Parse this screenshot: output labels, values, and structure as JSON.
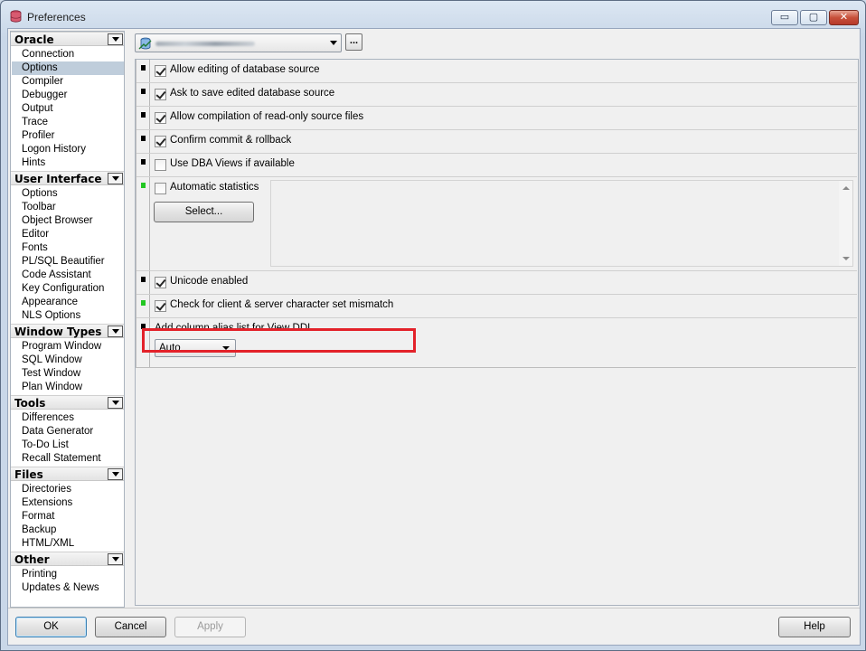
{
  "window": {
    "title": "Preferences",
    "controls": {
      "minimize": "▭",
      "maximize": "▢",
      "close": "✕"
    }
  },
  "sidebar": {
    "categories": [
      {
        "label": "Oracle",
        "items": [
          "Connection",
          "Options",
          "Compiler",
          "Debugger",
          "Output",
          "Trace",
          "Profiler",
          "Logon History",
          "Hints"
        ]
      },
      {
        "label": "User Interface",
        "items": [
          "Options",
          "Toolbar",
          "Object Browser",
          "Editor",
          "Fonts",
          "PL/SQL Beautifier",
          "Code Assistant",
          "Key Configuration",
          "Appearance",
          "NLS Options"
        ]
      },
      {
        "label": "Window Types",
        "items": [
          "Program Window",
          "SQL Window",
          "Test Window",
          "Plan Window"
        ]
      },
      {
        "label": "Tools",
        "items": [
          "Differences",
          "Data Generator",
          "To-Do List",
          "Recall Statement"
        ]
      },
      {
        "label": "Files",
        "items": [
          "Directories",
          "Extensions",
          "Format",
          "Backup",
          "HTML/XML"
        ]
      },
      {
        "label": "Other",
        "items": [
          "Printing",
          "Updates & News"
        ]
      }
    ],
    "selected": "Oracle/Options"
  },
  "top": {
    "dots_label": "..."
  },
  "options": [
    {
      "label": "Allow editing of database source",
      "checked": true
    },
    {
      "label": "Ask to save edited database source",
      "checked": true
    },
    {
      "label": "Allow compilation of read-only source files",
      "checked": true
    },
    {
      "label": "Confirm commit & rollback",
      "checked": true
    },
    {
      "label": "Use DBA Views if available",
      "checked": false
    },
    {
      "label": "Automatic statistics",
      "checked": false
    },
    {
      "label": "Unicode enabled",
      "checked": true
    },
    {
      "label": "Check for client & server character set mismatch",
      "checked": true
    }
  ],
  "stats_select_label": "Select...",
  "alias": {
    "label": "Add column alias list for View DDL",
    "value": "Auto"
  },
  "footer": {
    "ok": "OK",
    "cancel": "Cancel",
    "apply": "Apply",
    "help": "Help"
  }
}
